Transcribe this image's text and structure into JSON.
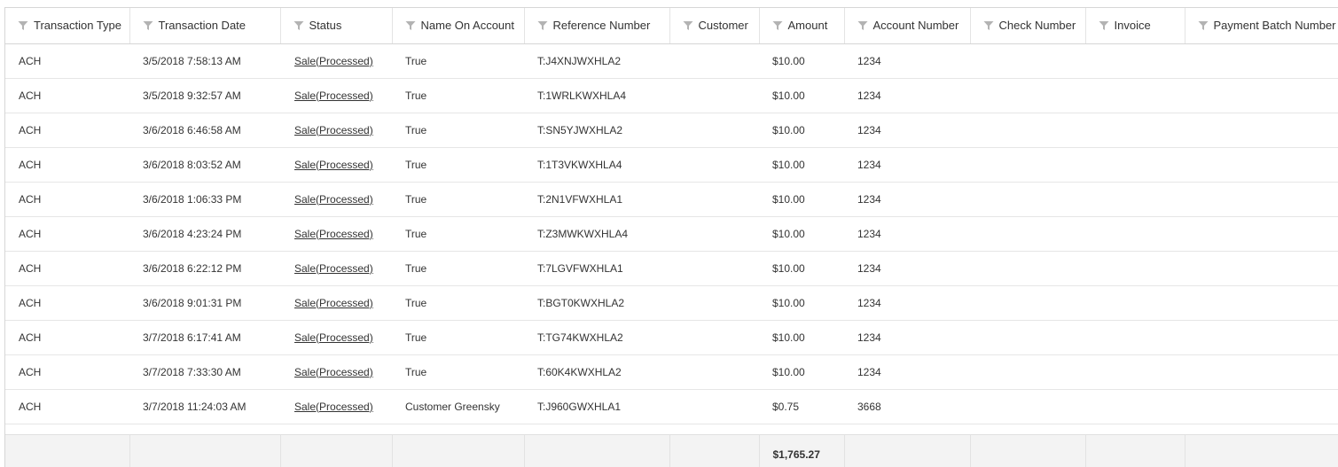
{
  "columns": [
    {
      "label": "Transaction Type",
      "filter_icon": "filter-icon"
    },
    {
      "label": "Transaction Date",
      "filter_icon": "filter-icon"
    },
    {
      "label": "Status",
      "filter_icon": "filter-icon"
    },
    {
      "label": "Name On Account",
      "filter_icon": "filter-icon"
    },
    {
      "label": "Reference Number",
      "filter_icon": "filter-icon"
    },
    {
      "label": "Customer",
      "filter_icon": "filter-icon"
    },
    {
      "label": "Amount",
      "filter_icon": "filter-icon"
    },
    {
      "label": "Account Number",
      "filter_icon": "filter-icon"
    },
    {
      "label": "Check Number",
      "filter_icon": "filter-icon"
    },
    {
      "label": "Invoice",
      "filter_icon": "filter-icon"
    },
    {
      "label": "Payment Batch Number",
      "filter_icon": "filter-icon"
    }
  ],
  "rows": [
    {
      "type": "ACH",
      "date": "3/5/2018 7:58:13 AM",
      "status": "Sale(Processed)",
      "name_on_account": "True",
      "reference": "T:J4XNJWXHLA2",
      "customer": "",
      "amount": "$10.00",
      "account_number": "1234",
      "check_number": "",
      "invoice": "",
      "batch": ""
    },
    {
      "type": "ACH",
      "date": "3/5/2018 9:32:57 AM",
      "status": "Sale(Processed)",
      "name_on_account": "True",
      "reference": "T:1WRLKWXHLA4",
      "customer": "",
      "amount": "$10.00",
      "account_number": "1234",
      "check_number": "",
      "invoice": "",
      "batch": ""
    },
    {
      "type": "ACH",
      "date": "3/6/2018 6:46:58 AM",
      "status": "Sale(Processed)",
      "name_on_account": "True",
      "reference": "T:SN5YJWXHLA2",
      "customer": "",
      "amount": "$10.00",
      "account_number": "1234",
      "check_number": "",
      "invoice": "",
      "batch": ""
    },
    {
      "type": "ACH",
      "date": "3/6/2018 8:03:52 AM",
      "status": "Sale(Processed)",
      "name_on_account": "True",
      "reference": "T:1T3VKWXHLA4",
      "customer": "",
      "amount": "$10.00",
      "account_number": "1234",
      "check_number": "",
      "invoice": "",
      "batch": ""
    },
    {
      "type": "ACH",
      "date": "3/6/2018 1:06:33 PM",
      "status": "Sale(Processed)",
      "name_on_account": "True",
      "reference": "T:2N1VFWXHLA1",
      "customer": "",
      "amount": "$10.00",
      "account_number": "1234",
      "check_number": "",
      "invoice": "",
      "batch": ""
    },
    {
      "type": "ACH",
      "date": "3/6/2018 4:23:24 PM",
      "status": "Sale(Processed)",
      "name_on_account": "True",
      "reference": "T:Z3MWKWXHLA4",
      "customer": "",
      "amount": "$10.00",
      "account_number": "1234",
      "check_number": "",
      "invoice": "",
      "batch": ""
    },
    {
      "type": "ACH",
      "date": "3/6/2018 6:22:12 PM",
      "status": "Sale(Processed)",
      "name_on_account": "True",
      "reference": "T:7LGVFWXHLA1",
      "customer": "",
      "amount": "$10.00",
      "account_number": "1234",
      "check_number": "",
      "invoice": "",
      "batch": ""
    },
    {
      "type": "ACH",
      "date": "3/6/2018 9:01:31 PM",
      "status": "Sale(Processed)",
      "name_on_account": "True",
      "reference": "T:BGT0KWXHLA2",
      "customer": "",
      "amount": "$10.00",
      "account_number": "1234",
      "check_number": "",
      "invoice": "",
      "batch": ""
    },
    {
      "type": "ACH",
      "date": "3/7/2018 6:17:41 AM",
      "status": "Sale(Processed)",
      "name_on_account": "True",
      "reference": "T:TG74KWXHLA2",
      "customer": "",
      "amount": "$10.00",
      "account_number": "1234",
      "check_number": "",
      "invoice": "",
      "batch": ""
    },
    {
      "type": "ACH",
      "date": "3/7/2018 7:33:30 AM",
      "status": "Sale(Processed)",
      "name_on_account": "True",
      "reference": "T:60K4KWXHLA2",
      "customer": "",
      "amount": "$10.00",
      "account_number": "1234",
      "check_number": "",
      "invoice": "",
      "batch": ""
    },
    {
      "type": "ACH",
      "date": "3/7/2018 11:24:03 AM",
      "status": "Sale(Processed)",
      "name_on_account": "Customer Greensky",
      "reference": "T:J960GWXHLA1",
      "customer": "",
      "amount": "$0.75",
      "account_number": "3668",
      "check_number": "",
      "invoice": "",
      "batch": ""
    }
  ],
  "footer": {
    "amount_total": "$1,765.27"
  },
  "colors": {
    "text": "#333333",
    "header_border": "#d6d6d6",
    "row_border": "#e6e6e6",
    "footer_bg": "#f3f3f3",
    "filter_icon": "#b3b3b3"
  }
}
